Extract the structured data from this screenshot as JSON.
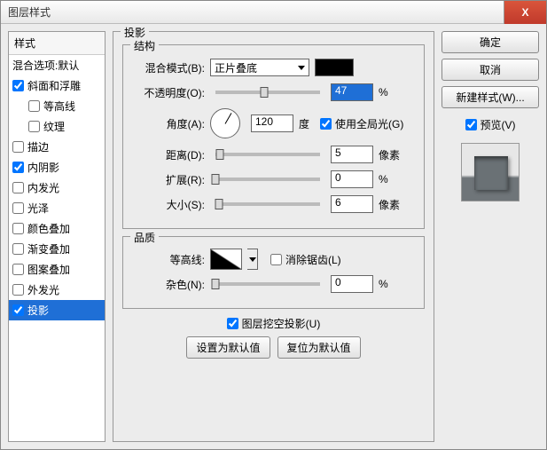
{
  "window": {
    "title": "图层样式"
  },
  "styles": {
    "header": "样式",
    "blending": "混合选项:默认",
    "items": [
      {
        "label": "斜面和浮雕",
        "checked": true,
        "indent": false
      },
      {
        "label": "等高线",
        "checked": false,
        "indent": true
      },
      {
        "label": "纹理",
        "checked": false,
        "indent": true
      },
      {
        "label": "描边",
        "checked": false,
        "indent": false
      },
      {
        "label": "内阴影",
        "checked": true,
        "indent": false
      },
      {
        "label": "内发光",
        "checked": false,
        "indent": false
      },
      {
        "label": "光泽",
        "checked": false,
        "indent": false
      },
      {
        "label": "颜色叠加",
        "checked": false,
        "indent": false
      },
      {
        "label": "渐变叠加",
        "checked": false,
        "indent": false
      },
      {
        "label": "图案叠加",
        "checked": false,
        "indent": false
      },
      {
        "label": "外发光",
        "checked": false,
        "indent": false
      },
      {
        "label": "投影",
        "checked": true,
        "indent": false,
        "selected": true
      }
    ]
  },
  "section": {
    "title": "投影",
    "structure": {
      "title": "结构",
      "blend_mode_label": "混合模式(B):",
      "blend_mode_value": "正片叠底",
      "opacity_label": "不透明度(O):",
      "opacity_value": "47",
      "opacity_unit": "%",
      "angle_label": "角度(A):",
      "angle_value": "120",
      "angle_unit": "度",
      "global_light": "使用全局光(G)",
      "distance_label": "距离(D):",
      "distance_value": "5",
      "distance_unit": "像素",
      "spread_label": "扩展(R):",
      "spread_value": "0",
      "spread_unit": "%",
      "size_label": "大小(S):",
      "size_value": "6",
      "size_unit": "像素"
    },
    "quality": {
      "title": "品质",
      "contour_label": "等高线:",
      "antialias": "消除锯齿(L)",
      "noise_label": "杂色(N):",
      "noise_value": "0",
      "noise_unit": "%"
    },
    "knockout": "图层挖空投影(U)",
    "make_default": "设置为默认值",
    "reset_default": "复位为默认值"
  },
  "buttons": {
    "ok": "确定",
    "cancel": "取消",
    "new_style": "新建样式(W)...",
    "preview": "预览(V)"
  }
}
